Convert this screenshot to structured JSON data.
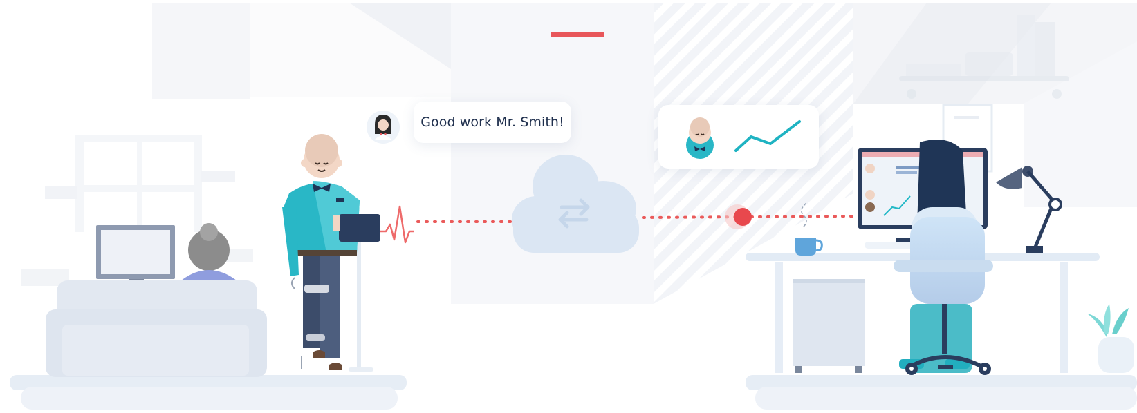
{
  "speech": {
    "text": "Good work Mr. Smith!"
  },
  "colors": {
    "accent": "#e8565a",
    "navy": "#1f3556",
    "teal": "#22b8c6",
    "cloud": "#dde9f5",
    "furniture": "#e9eef6",
    "floor": "#edf2f8"
  },
  "icons": [
    "clinician-avatar-icon",
    "patient-avatar-icon",
    "trend-line-icon",
    "sync-arrows-icon",
    "heartbeat-wave-icon",
    "coffee-cup-icon",
    "desk-lamp-icon"
  ]
}
